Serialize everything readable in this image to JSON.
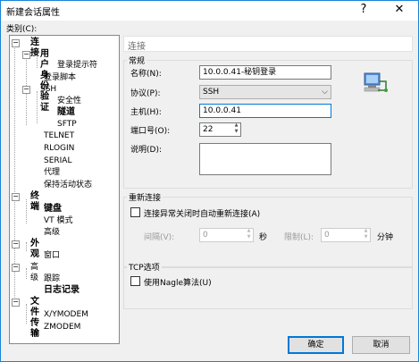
{
  "window": {
    "title": "新建会话属性",
    "help": "?",
    "close": "✕"
  },
  "category_label": "类别(C):",
  "tree": [
    {
      "label": "连接",
      "bold": true
    },
    {
      "label": "用户身份验证",
      "bold": true
    },
    {
      "label": "登录提示符"
    },
    {
      "label": "登录脚本"
    },
    {
      "label": "SSH"
    },
    {
      "label": "安全性"
    },
    {
      "label": "隧道",
      "bold": true
    },
    {
      "label": "SFTP"
    },
    {
      "label": "TELNET"
    },
    {
      "label": "RLOGIN"
    },
    {
      "label": "SERIAL"
    },
    {
      "label": "代理"
    },
    {
      "label": "保持活动状态"
    },
    {
      "label": "终端",
      "bold": true
    },
    {
      "label": "键盘",
      "bold": true
    },
    {
      "label": "VT 模式"
    },
    {
      "label": "高级"
    },
    {
      "label": "外观",
      "bold": true
    },
    {
      "label": "窗口"
    },
    {
      "label": "高级"
    },
    {
      "label": "跟踪"
    },
    {
      "label": "日志记录",
      "bold": true
    },
    {
      "label": "文件传输",
      "bold": true
    },
    {
      "label": "X/YMODEM"
    },
    {
      "label": "ZMODEM"
    }
  ],
  "pane_title": "连接",
  "general": {
    "group_label": "常规",
    "name_label": "名称(N):",
    "name_value": "10.0.0.41-秘钥登录",
    "protocol_label": "协议(P):",
    "protocol_value": "SSH",
    "host_label": "主机(H):",
    "host_value": "10.0.0.41",
    "port_label": "端口号(O):",
    "port_value": "22",
    "desc_label": "说明(D):",
    "desc_value": ""
  },
  "reconnect": {
    "group_label": "重新连接",
    "checkbox_label": "连接异常关闭时自动重新连接(A)",
    "interval_label": "间隔(V):",
    "interval_value": "0",
    "interval_unit": "秒",
    "limit_label": "限制(L):",
    "limit_value": "0",
    "limit_unit": "分钟"
  },
  "tcp": {
    "group_label": "TCP选项",
    "nagle_label": "使用Nagle算法(U)"
  },
  "buttons": {
    "ok": "确定",
    "cancel": "取消"
  }
}
